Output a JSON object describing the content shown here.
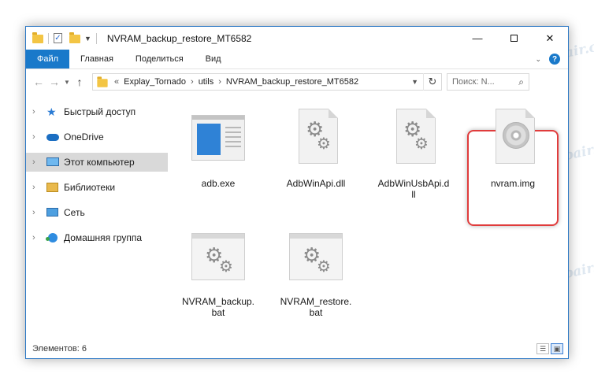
{
  "window": {
    "title": "NVRAM_backup_restore_MT6582",
    "controls": {
      "minimize": "—",
      "close": "✕"
    }
  },
  "ribbon": {
    "tabs": [
      "Файл",
      "Главная",
      "Поделиться",
      "Вид"
    ],
    "help": "?"
  },
  "address": {
    "prefix": "«",
    "breadcrumbs": [
      "Explay_Tornado",
      "utils",
      "NVRAM_backup_restore_MT6582"
    ],
    "separator": "›"
  },
  "search": {
    "placeholder": "Поиск: N..."
  },
  "nav": {
    "back": "←",
    "forward": "→",
    "up": "↑",
    "items": [
      {
        "label": "Быстрый доступ",
        "icon": "star-icon"
      },
      {
        "label": "OneDrive",
        "icon": "cloud-icon"
      },
      {
        "label": "Этот компьютер",
        "icon": "computer-icon",
        "selected": true
      },
      {
        "label": "Библиотеки",
        "icon": "library-icon"
      },
      {
        "label": "Сеть",
        "icon": "network-icon"
      },
      {
        "label": "Домашняя группа",
        "icon": "homegroup-icon"
      }
    ]
  },
  "files": [
    {
      "name": "adb.exe",
      "type": "exe"
    },
    {
      "name": "AdbWinApi.dll",
      "type": "dll"
    },
    {
      "name": "AdbWinUsbApi.dll",
      "line1": "AdbWinUsbApi.d",
      "line2": "ll",
      "type": "dll"
    },
    {
      "name": "nvram.img",
      "type": "img",
      "highlighted": true
    },
    {
      "name": "NVRAM_backup.bat",
      "line1": "NVRAM_backup.",
      "line2": "bat",
      "type": "bat"
    },
    {
      "name": "NVRAM_restore.bat",
      "line1": "NVRAM_restore.",
      "line2": "bat",
      "type": "bat"
    }
  ],
  "status": {
    "items_text": "Элементов: 6"
  },
  "watermark": "Sovingperpair.com",
  "colors": {
    "accent": "#1979ca",
    "highlight_border": "#e03c3c",
    "selected_nav": "#d9d9d9"
  }
}
